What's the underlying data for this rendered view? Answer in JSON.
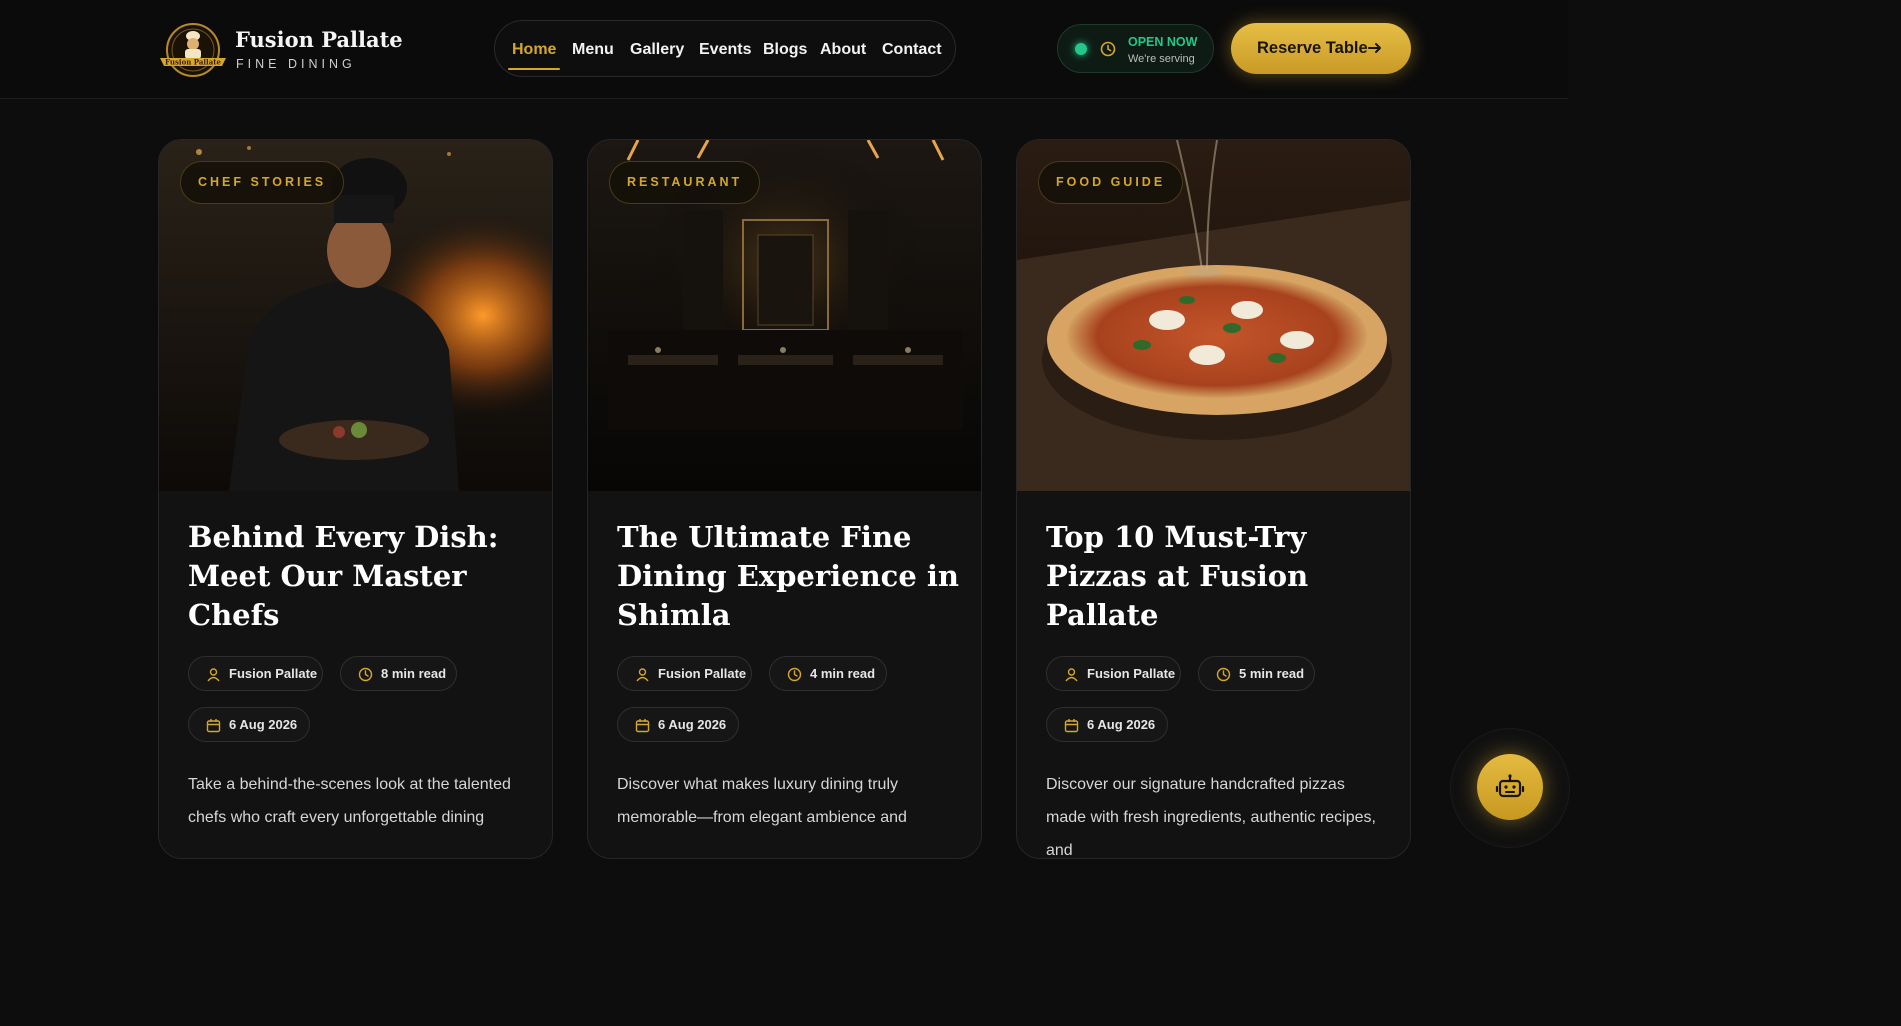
{
  "brand": {
    "name": "Fusion Pallate",
    "tagline": "FINE DINING",
    "logo_text": "Fusion Pallate"
  },
  "nav": {
    "items": [
      {
        "label": "Home",
        "active": true
      },
      {
        "label": "Menu",
        "active": false
      },
      {
        "label": "Gallery",
        "active": false
      },
      {
        "label": "Events",
        "active": false
      },
      {
        "label": "Blogs",
        "active": false
      },
      {
        "label": "About",
        "active": false
      },
      {
        "label": "Contact",
        "active": false
      }
    ]
  },
  "status": {
    "title": "OPEN NOW",
    "subtitle": "We're serving"
  },
  "reserve": {
    "label": "Reserve Table"
  },
  "cards": [
    {
      "category": "CHEF STORIES",
      "title": "Behind Every Dish: Meet Our Master Chefs",
      "author": "Fusion Pallate",
      "read_time": "8 min read",
      "date": "6 Aug 2026",
      "excerpt": "Take a behind-the-scenes look at the talented chefs who craft every unforgettable dining"
    },
    {
      "category": "RESTAURANT",
      "title": "The Ultimate Fine Dining Experience in Shimla",
      "author": "Fusion Pallate",
      "read_time": "4 min read",
      "date": "6 Aug 2026",
      "excerpt": "Discover what makes luxury dining truly memorable—from elegant ambience and"
    },
    {
      "category": "FOOD GUIDE",
      "title": "Top 10 Must-Try Pizzas at Fusion Pallate",
      "author": "Fusion Pallate",
      "read_time": "5 min read",
      "date": "6 Aug 2026",
      "excerpt": "Discover our signature handcrafted pizzas made with fresh ingredients, authentic recipes, and"
    }
  ],
  "icons": {
    "author": "user-icon",
    "read_time": "clock-icon",
    "date": "calendar-icon",
    "status": "clock-icon",
    "reserve": "arrow-right-icon",
    "chat": "robot-icon"
  },
  "colors": {
    "accent": "#d4a72c",
    "open_status": "#22c78a",
    "background": "#0d0d0d"
  }
}
